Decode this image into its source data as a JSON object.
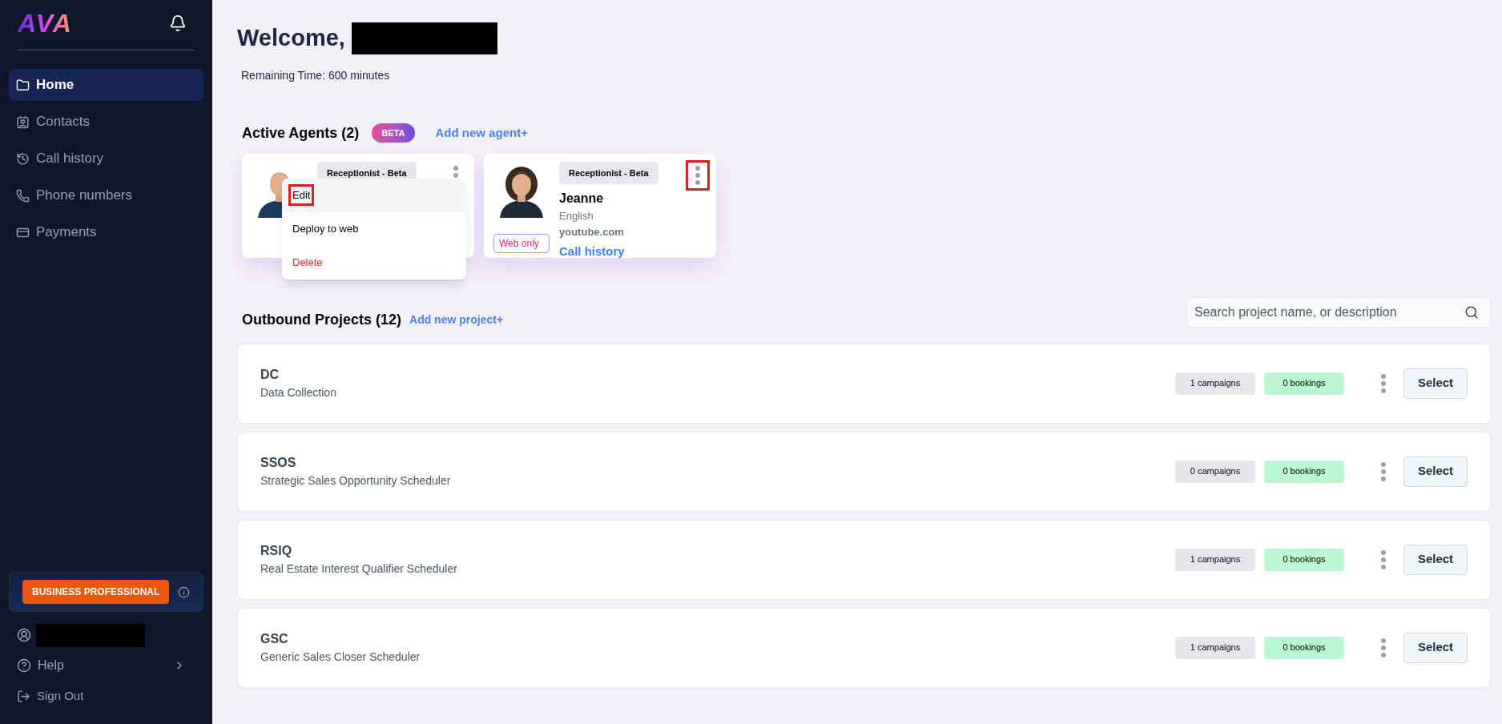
{
  "sidebar": {
    "logo": "AVA",
    "nav": [
      {
        "label": "Home",
        "selected": true
      },
      {
        "label": "Contacts",
        "selected": false
      },
      {
        "label": "Call history",
        "selected": false
      },
      {
        "label": "Phone numbers",
        "selected": false
      },
      {
        "label": "Payments",
        "selected": false
      }
    ],
    "plan_badge": "BUSINESS PROFESSIONAL",
    "footer": [
      {
        "kind": "user"
      },
      {
        "kind": "help",
        "label": "Help"
      },
      {
        "kind": "signout",
        "label": "Sign Out"
      }
    ]
  },
  "header": {
    "welcome": "Welcome,",
    "remaining_time": "Remaining Time: 600 minutes"
  },
  "agents": {
    "title": "Active Agents (2)",
    "badge": "BETA",
    "add_link": "Add new agent+",
    "cards": [
      {
        "role": "Receptionist - Beta",
        "menu_highlighted": false,
        "menu": [
          {
            "label": "Edit",
            "kind": "normal",
            "selected": true,
            "highlighted": true
          },
          {
            "label": "Deploy to web",
            "kind": "normal",
            "selected": false,
            "highlighted": false
          },
          {
            "label": "Delete",
            "kind": "danger",
            "selected": false,
            "highlighted": false
          }
        ]
      },
      {
        "role": "Receptionist - Beta",
        "name": "Jeanne",
        "language": "English",
        "site": "youtube.com",
        "tag": "Web only",
        "link": "Call history",
        "menu_highlighted": true
      }
    ]
  },
  "projects": {
    "title": "Outbound Projects (12)",
    "add_link": "Add new project+",
    "search": {
      "placeholder": "Search project name, or description"
    },
    "rows": [
      {
        "code": "DC",
        "name": "Data Collection",
        "campaigns": "1 campaigns",
        "bookings": "0 bookings",
        "button": "Select"
      },
      {
        "code": "SSOS",
        "name": "Strategic Sales Opportunity Scheduler",
        "campaigns": "0 campaigns",
        "bookings": "0 bookings",
        "button": "Select"
      },
      {
        "code": "RSIQ",
        "name": "Real Estate Interest Qualifier Scheduler",
        "campaigns": "1 campaigns",
        "bookings": "0 bookings",
        "button": "Select"
      },
      {
        "code": "GSC",
        "name": "Generic Sales Closer Scheduler",
        "campaigns": "1 campaigns",
        "bookings": "0 bookings",
        "button": "Select"
      }
    ]
  }
}
